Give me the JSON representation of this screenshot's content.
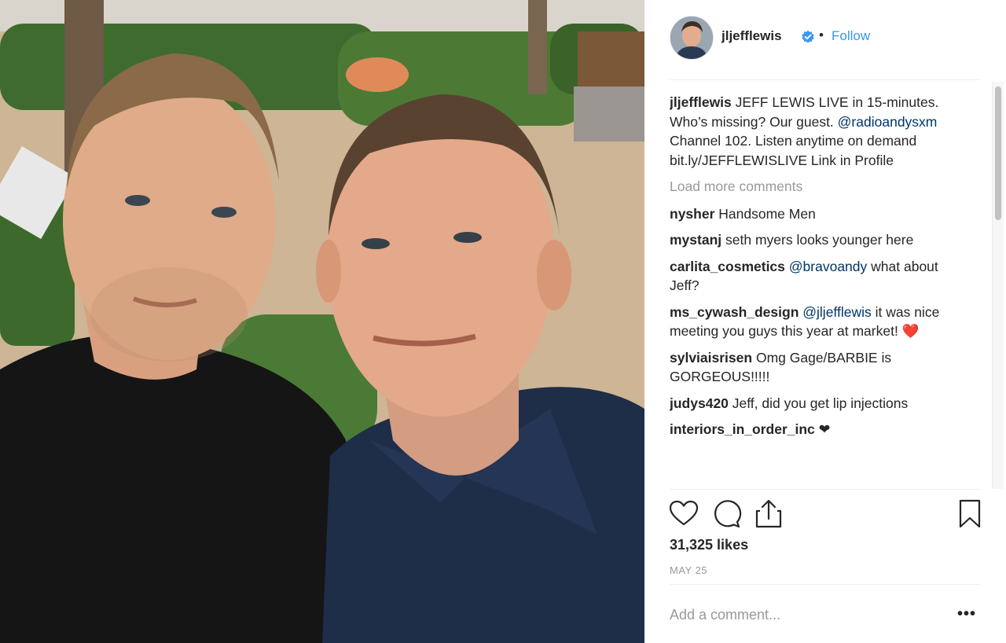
{
  "photo": {
    "description_icon": "selfie-photo"
  },
  "header": {
    "username": "jljefflewis",
    "separator": "•",
    "follow_label": "Follow",
    "verified_icon": "verified-badge-icon"
  },
  "caption": {
    "username": "jljefflewis",
    "text_1": "JEFF LEWIS LIVE in 15-minutes. Who’s missing? Our guest.",
    "mention": "@radioandysxm",
    "text_2": "Channel 102. Listen anytime on demand bit.ly/JEFFLEWISLIVE Link in Profile"
  },
  "load_more": "Load more comments",
  "comments": [
    {
      "user": "nysher",
      "text": "Handsome Men"
    },
    {
      "user": "mystanj",
      "text": "seth myers looks younger here"
    },
    {
      "user": "carlita_cosmetics",
      "mention": "@bravoandy",
      "text": "what about Jeff?"
    },
    {
      "user": "ms_cywash_design",
      "mention": "@jljefflewis",
      "text": "it was nice meeting you guys this year at market!",
      "emoji": "❤️"
    },
    {
      "user": "sylviaisrisen",
      "text": "Omg Gage/BARBIE is GORGEOUS!!!!!"
    },
    {
      "user": "judys420",
      "text": "Jeff, did you get lip injections"
    },
    {
      "user": "interiors_in_order_inc",
      "text": "❤"
    }
  ],
  "actions": {
    "like_icon": "heart-icon",
    "comment_icon": "comment-icon",
    "share_icon": "share-icon",
    "save_icon": "bookmark-icon"
  },
  "likes": "31,325 likes",
  "date": "MAY 25",
  "add_comment": {
    "placeholder": "Add a comment..."
  },
  "more_label": "•••",
  "colors": {
    "link": "#3897f0",
    "mention": "#003569",
    "muted": "#999999"
  }
}
